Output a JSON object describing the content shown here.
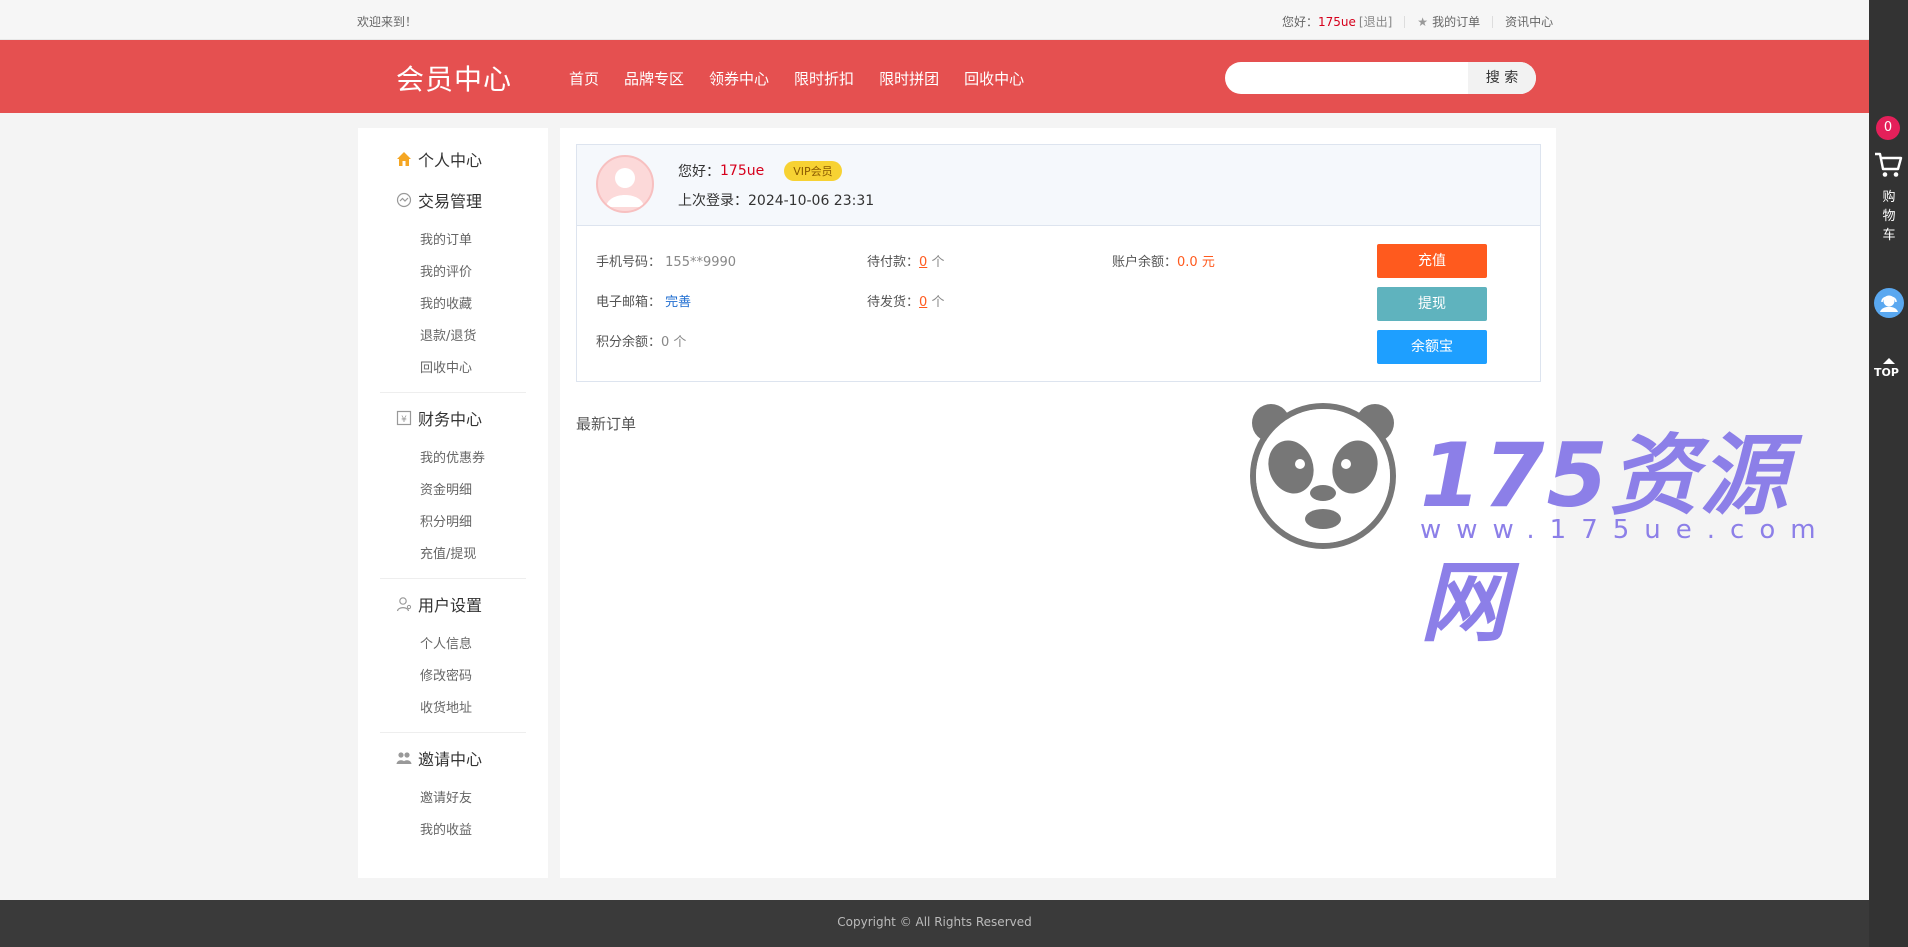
{
  "topbar": {
    "welcome": "欢迎来到！",
    "hello_prefix": "您好：",
    "username": "175ue",
    "logout": "[退出]",
    "my_orders": "我的订单",
    "news_center": "资讯中心"
  },
  "header": {
    "logo": "会员中心",
    "nav": [
      "首页",
      "品牌专区",
      "领券中心",
      "限时折扣",
      "限时拼团",
      "回收中心"
    ],
    "search_placeholder": "",
    "search_button": "搜 索"
  },
  "sidebar": {
    "groups": [
      {
        "title": "个人中心",
        "icon": "home-icon",
        "items": []
      },
      {
        "title": "交易管理",
        "icon": "transaction-icon",
        "items": [
          "我的订单",
          "我的评价",
          "我的收藏",
          "退款/退货",
          "回收中心"
        ]
      },
      {
        "title": "财务中心",
        "icon": "finance-icon",
        "items": [
          "我的优惠券",
          "资金明细",
          "积分明细",
          "充值/提现"
        ]
      },
      {
        "title": "用户设置",
        "icon": "user-settings-icon",
        "items": [
          "个人信息",
          "修改密码",
          "收货地址"
        ]
      },
      {
        "title": "邀请中心",
        "icon": "invite-icon",
        "items": [
          "邀请好友",
          "我的收益"
        ]
      }
    ]
  },
  "profile": {
    "hello_prefix": "您好：",
    "username": "175ue",
    "vip_badge": "VIP会员",
    "last_login_label": "上次登录：",
    "last_login": "2024-10-06 23:31",
    "phone_label": "手机号码：",
    "phone": "155**9990",
    "email_label": "电子邮箱：",
    "email_action": "完善",
    "points_label": "积分余额：",
    "points": "0 个",
    "pending_pay_label": "待付款：",
    "pending_pay": "0",
    "pending_ship_label": "待发货：",
    "pending_ship": "0",
    "unit": "个",
    "balance_label": "账户余额：",
    "balance": "0.0 元",
    "buttons": {
      "recharge": "充值",
      "withdraw": "提现",
      "yuebao": "余额宝"
    },
    "button_colors": {
      "recharge": "#ff5a1e",
      "withdraw": "#5fb3be",
      "yuebao": "#1e9fff"
    }
  },
  "latest_orders_title": "最新订单",
  "watermark": {
    "text": "175资源网",
    "url": "www.175ue.com"
  },
  "dock": {
    "cart_count": "0",
    "cart_label": "购物车",
    "top_label": "TOP"
  },
  "footer": {
    "copyright": "Copyright © All Rights Reserved"
  },
  "colors": {
    "brand": "#e55050",
    "accent_text": "#d6001c",
    "watermark": "#8c7fe8"
  }
}
